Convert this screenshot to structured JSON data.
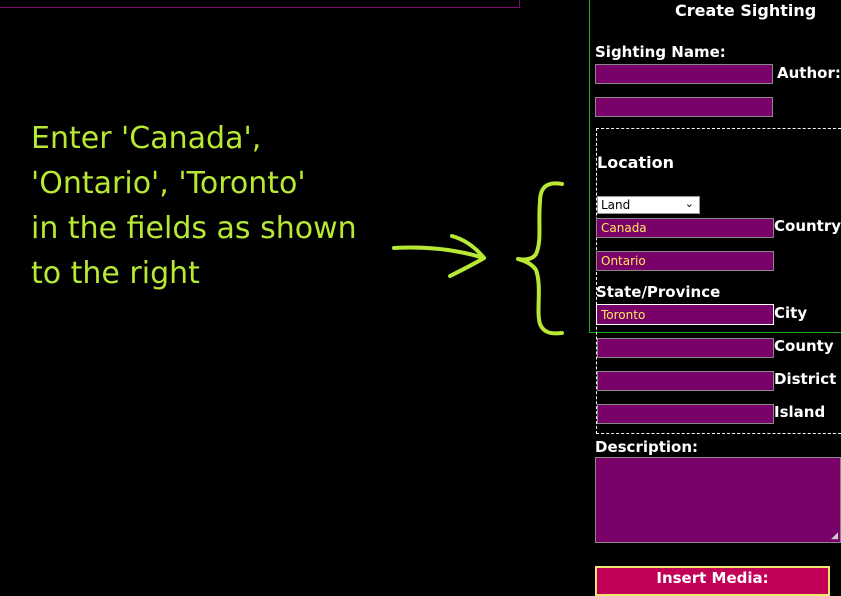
{
  "annotation": {
    "lines": [
      "Enter 'Canada',",
      "'Ontario', 'Toronto'",
      "in the fields as shown",
      "to the right"
    ],
    "color": "#b7e934"
  },
  "form": {
    "title": "Create Sighting",
    "sighting_name_label": "Sighting Name:",
    "sighting_name_value": "",
    "author_label": "Author:",
    "author_value": "",
    "location": {
      "heading": "Location",
      "type_select": "Land",
      "country_value": "Canada",
      "country_label": "Country",
      "state_value": "Ontario",
      "state_label": "State/Province",
      "city_value": "Toronto",
      "city_label": "City",
      "county_value": "",
      "county_label": "County",
      "district_value": "",
      "district_label": "District",
      "island_value": "",
      "island_label": "Island"
    },
    "description_label": "Description:",
    "description_value": "",
    "insert_media_label": "Insert Media:"
  },
  "colors": {
    "field_bg": "#7a006a",
    "field_text": "#ffe75c",
    "accent_button": "#c20057",
    "button_border": "#f1e76a",
    "panel_border": "#1ea91e"
  }
}
